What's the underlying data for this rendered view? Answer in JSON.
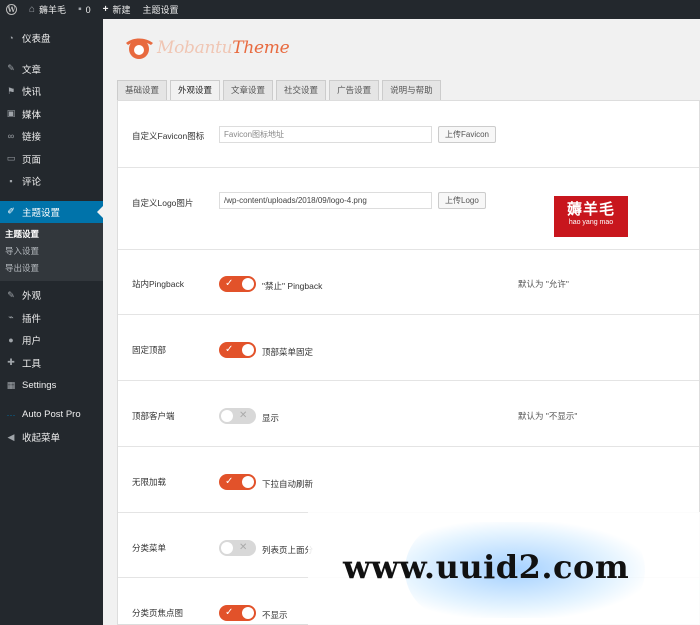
{
  "admin_bar": {
    "site_name": "薅羊毛",
    "comments_count": "0",
    "new_label": "新建",
    "theme_settings_label": "主题设置"
  },
  "sidebar": {
    "items": [
      {
        "label": "仪表盘",
        "icon": "dashboard-icon"
      },
      {
        "label": "文章",
        "icon": "pin-icon"
      },
      {
        "label": "快讯",
        "icon": "flag-icon"
      },
      {
        "label": "媒体",
        "icon": "media-icon"
      },
      {
        "label": "链接",
        "icon": "link-icon"
      },
      {
        "label": "页面",
        "icon": "page-icon"
      },
      {
        "label": "评论",
        "icon": "comment-icon"
      },
      {
        "label": "主题设置",
        "icon": "wrench-icon",
        "active": true
      },
      {
        "label": "外观",
        "icon": "brush-icon"
      },
      {
        "label": "插件",
        "icon": "plugin-icon"
      },
      {
        "label": "用户",
        "icon": "user-icon"
      },
      {
        "label": "工具",
        "icon": "tool-icon"
      },
      {
        "label": "Settings",
        "icon": "settings-icon"
      },
      {
        "label": "Auto Post Pro",
        "icon": "ellipsis-icon"
      },
      {
        "label": "收起菜单",
        "icon": "collapse-icon"
      }
    ],
    "submenu": [
      "主题设置",
      "导入设置",
      "导出设置"
    ]
  },
  "logo": {
    "part1": "Mobantu",
    "part2": "Theme"
  },
  "tabs": [
    "基础设置",
    "外观设置",
    "文章设置",
    "社交设置",
    "广告设置",
    "说明与帮助"
  ],
  "active_tab": 1,
  "fields": {
    "favicon": {
      "label": "自定义Favicon图标",
      "placeholder": "Favicon图标地址",
      "button": "上传Favicon"
    },
    "logo": {
      "label": "自定义Logo图片",
      "value": "/wp-content/uploads/2018/09/logo-4.png",
      "button": "上传Logo",
      "preview_main": "薅羊毛",
      "preview_sub": "hao yang mao"
    }
  },
  "toggles": [
    {
      "label": "站内Pingback",
      "on": true,
      "desc": "\"禁止\" Pingback",
      "note": "默认为 \"允许\""
    },
    {
      "label": "固定顶部",
      "on": true,
      "desc": "顶部菜单固定",
      "note": ""
    },
    {
      "label": "顶部客户端",
      "on": false,
      "desc": "显示",
      "note": "默认为 \"不显示\""
    },
    {
      "label": "无限加载",
      "on": true,
      "desc": "下拉自动刷新",
      "note": ""
    },
    {
      "label": "分类菜单",
      "on": false,
      "desc": "列表页上面分",
      "note": ""
    },
    {
      "label": "分类页焦点图",
      "on": true,
      "desc": "不显示",
      "note": ""
    }
  ],
  "watermark": "www.uuid2.com",
  "colors": {
    "accent": "#e2522a",
    "admin_blue": "#0073aa",
    "admin_dark": "#23282d"
  }
}
